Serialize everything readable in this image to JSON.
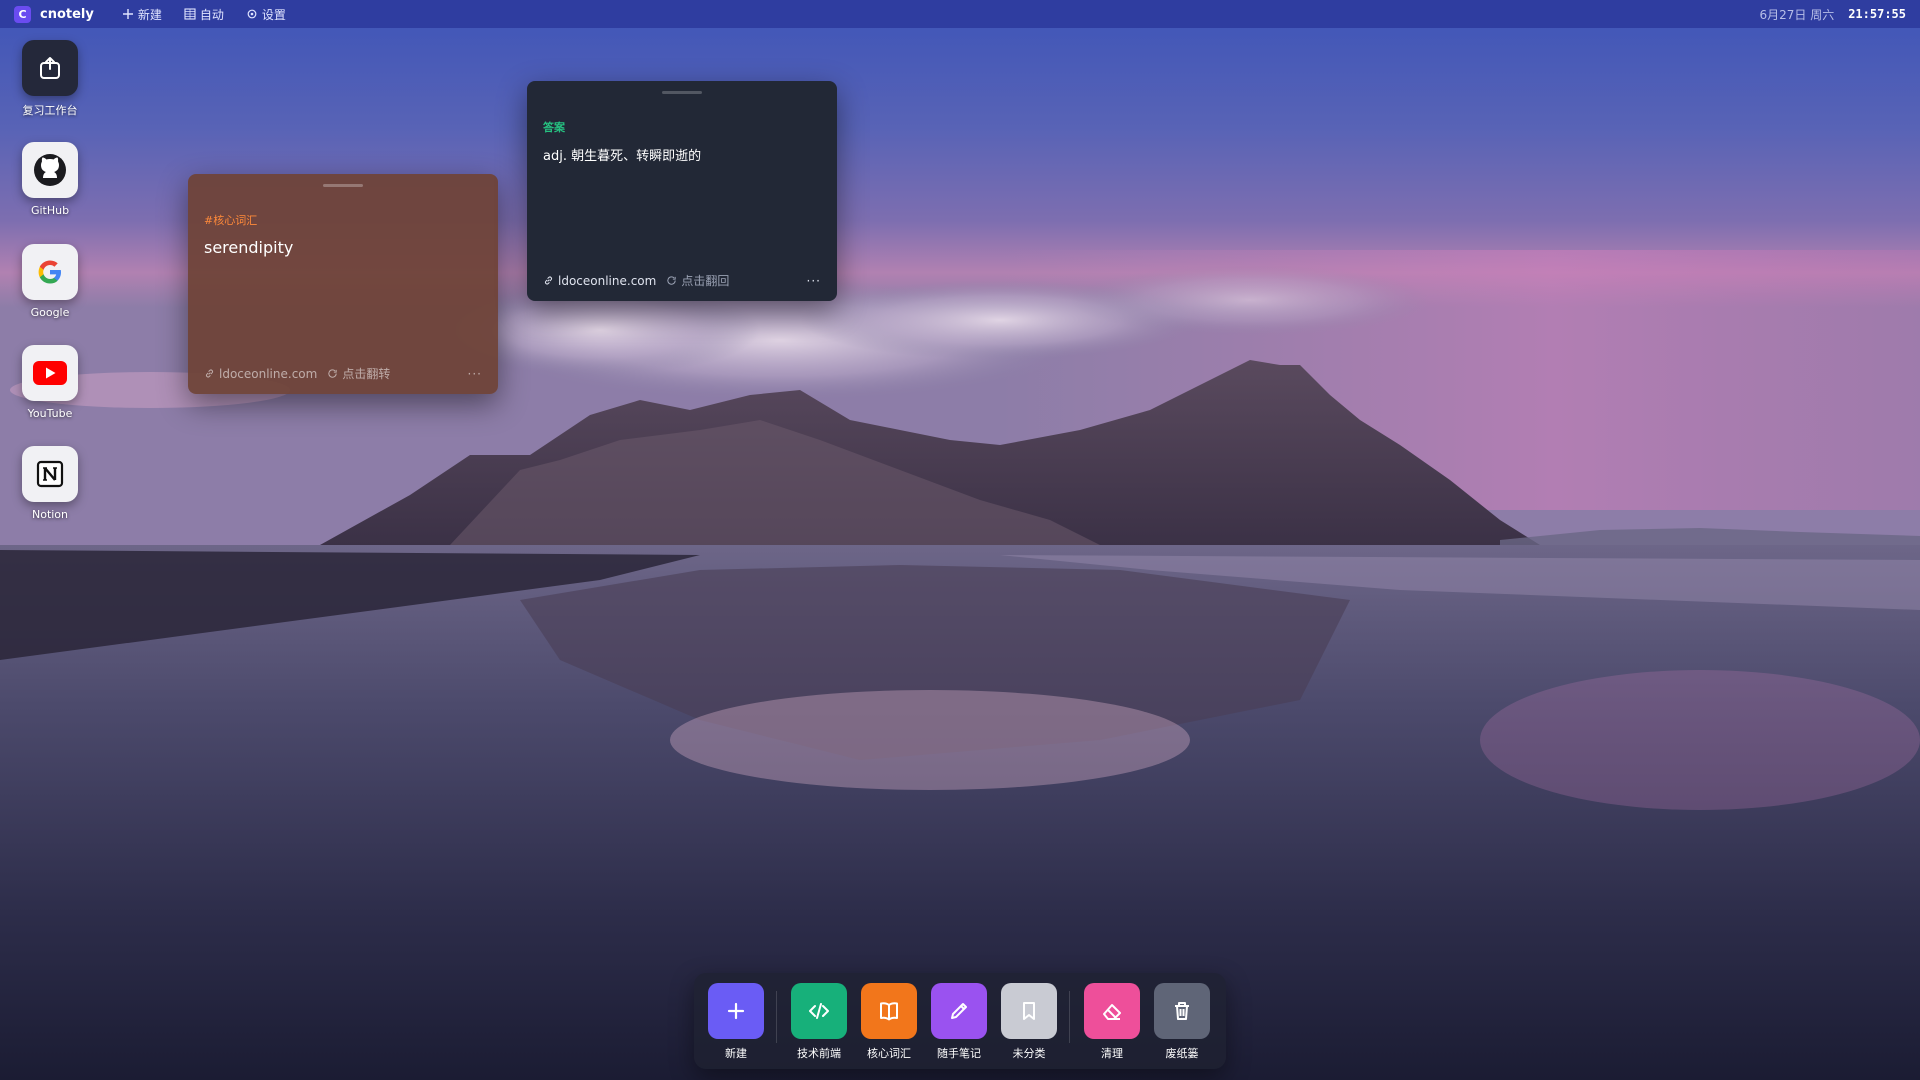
{
  "colors": {
    "topbar": "#2f3da0",
    "accent": "#6a4cf0",
    "tag_orange": "#ff8a3a",
    "tag_green": "#26c281"
  },
  "topbar": {
    "logo_letter": "C",
    "app_name": "cnotely",
    "menu": [
      {
        "label": "新建",
        "icon": "plus-icon"
      },
      {
        "label": "自动",
        "icon": "grid-icon"
      },
      {
        "label": "设置",
        "icon": "gear-icon"
      }
    ],
    "date": "6月27日 周六",
    "time": "21:57:55"
  },
  "desktop_icons": [
    {
      "label": "复习工作台",
      "icon": "review-workspace-icon"
    },
    {
      "label": "GitHub",
      "icon": "github-icon"
    },
    {
      "label": "Google",
      "icon": "google-icon"
    },
    {
      "label": "YouTube",
      "icon": "youtube-icon"
    },
    {
      "label": "Notion",
      "icon": "notion-icon"
    }
  ],
  "cards": {
    "front": {
      "tag": "#核心词汇",
      "text": "serendipity",
      "link": "ldoceonline.com",
      "flip_label": "点击翻转",
      "more": "···"
    },
    "back": {
      "tag": "答案",
      "text": "adj. 朝生暮死、转瞬即逝的",
      "link": "ldoceonline.com",
      "flip_label": "点击翻回",
      "more": "···"
    }
  },
  "dock": [
    {
      "label": "新建",
      "icon": "plus-icon",
      "color": "#6a5cf5"
    },
    {
      "label": "技术前端",
      "icon": "code-icon",
      "color": "#17b07a"
    },
    {
      "label": "核心词汇",
      "icon": "book-icon",
      "color": "#f2761b"
    },
    {
      "label": "随手笔记",
      "icon": "pencil-icon",
      "color": "#9a52f0"
    },
    {
      "label": "未分类",
      "icon": "bookmark-icon",
      "color": "#c9cbd3"
    },
    {
      "label": "清理",
      "icon": "eraser-icon",
      "color": "#ee4f9a"
    },
    {
      "label": "废纸篓",
      "icon": "trash-icon",
      "color": "#5f6577"
    }
  ]
}
